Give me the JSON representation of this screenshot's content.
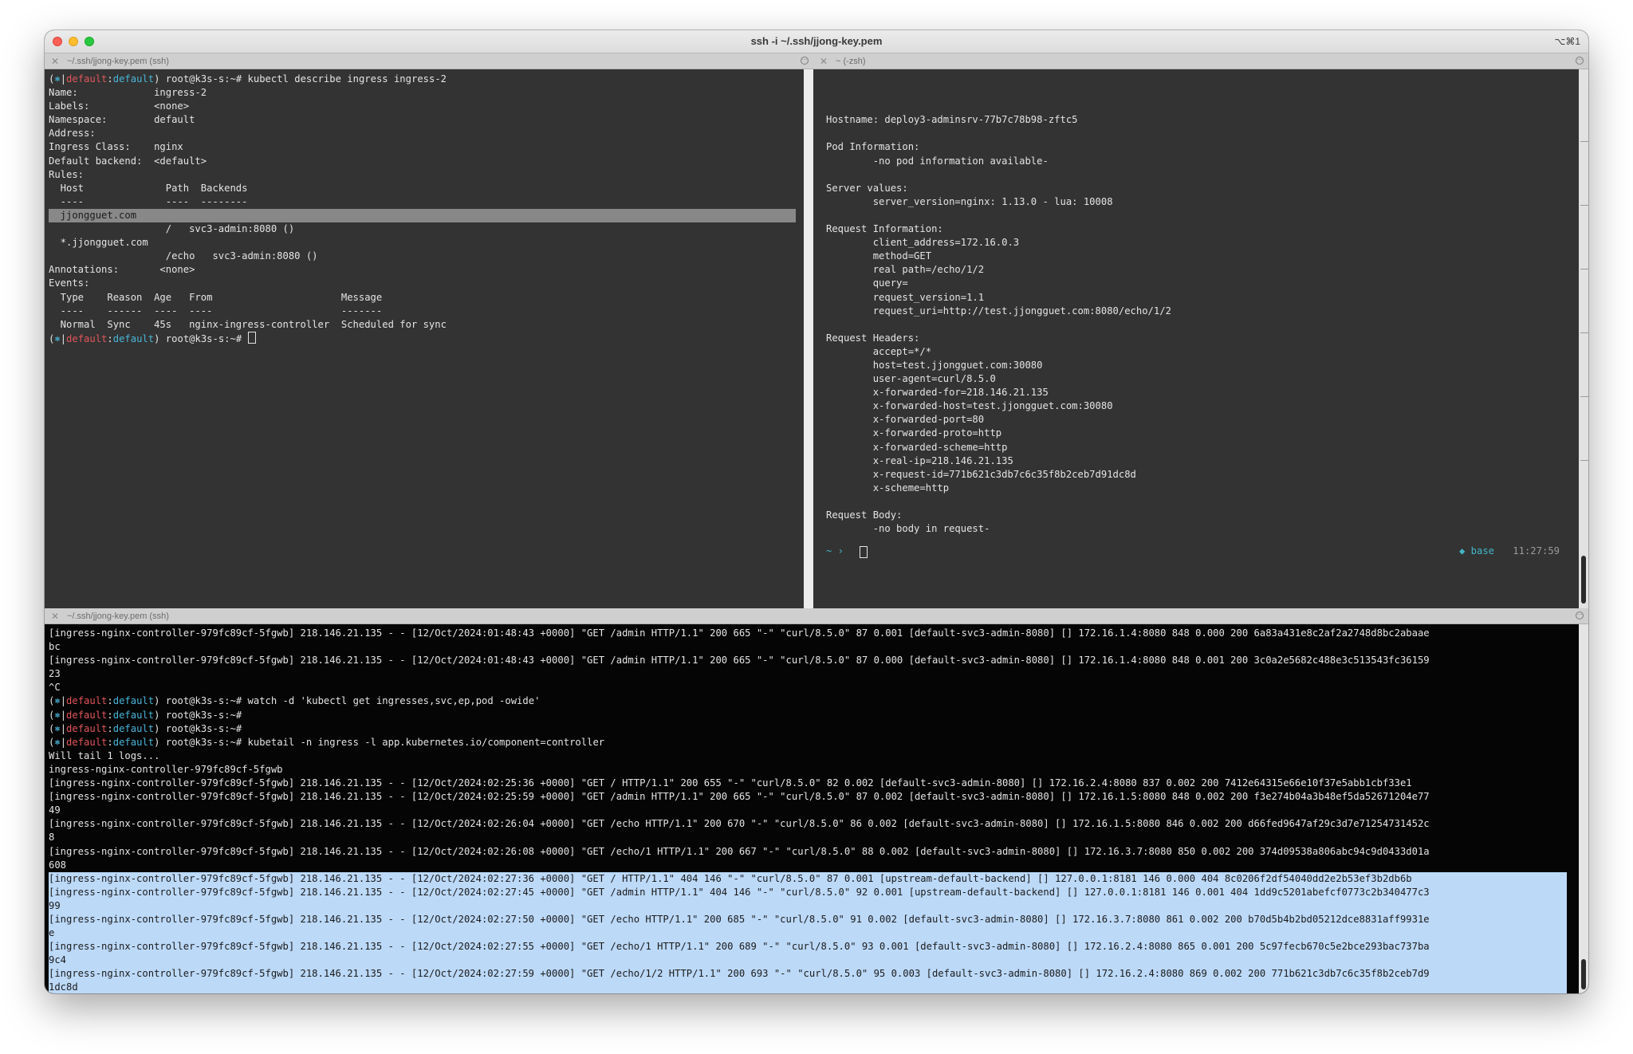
{
  "window": {
    "title": "ssh -i ~/.ssh/jjong-key.pem",
    "shortcut": "⌥⌘1"
  },
  "panes": {
    "top_left": {
      "tab_label": "~/.ssh/jjong-key.pem (ssh)"
    },
    "top_right": {
      "tab_label": "~ (-zsh)"
    },
    "bottom": {
      "tab_label": "~/.ssh/jjong-key.pem (ssh)"
    }
  },
  "prompt": {
    "open": "(",
    "star": "⎈",
    "sep": "|",
    "ctx": "default",
    "colon": ":",
    "ns": "default",
    "close": ")",
    "user": " root@k3s-s:~# "
  },
  "describe": {
    "command": "kubectl describe ingress ingress-2",
    "lines": [
      "Name:             ingress-2",
      "Labels:           <none>",
      "Namespace:        default",
      "Address:",
      "Ingress Class:    nginx",
      "Default backend:  <default>",
      "Rules:",
      "  Host              Path  Backends",
      "  ----              ----  --------",
      "  jjongguet.com",
      "                    /   svc3-admin:8080 ()",
      "  *.jjongguet.com",
      "                    /echo   svc3-admin:8080 ()",
      "Annotations:       <none>",
      "Events:",
      "  Type    Reason  Age   From                      Message",
      "  ----    ------  ----  ----                      -------",
      "  Normal  Sync    45s   nginx-ingress-controller  Scheduled for sync"
    ]
  },
  "echo_output": {
    "lines": [
      "",
      "",
      "",
      "Hostname: deploy3-adminsrv-77b7c78b98-zftc5",
      "",
      "Pod Information:",
      "        -no pod information available-",
      "",
      "Server values:",
      "        server_version=nginx: 1.13.0 - lua: 10008",
      "",
      "Request Information:",
      "        client_address=172.16.0.3",
      "        method=GET",
      "        real path=/echo/1/2",
      "        query=",
      "        request_version=1.1",
      "        request_uri=http://test.jjongguet.com:8080/echo/1/2",
      "",
      "Request Headers:",
      "        accept=*/*",
      "        host=test.jjongguet.com:30080",
      "        user-agent=curl/8.5.0",
      "        x-forwarded-for=218.146.21.135",
      "        x-forwarded-host=test.jjongguet.com:30080",
      "        x-forwarded-port=80",
      "        x-forwarded-proto=http",
      "        x-forwarded-scheme=http",
      "        x-real-ip=218.146.21.135",
      "        x-request-id=771b621c3db7c6c35f8b2ceb7d91dc8d",
      "        x-scheme=http",
      "",
      "Request Body:",
      "        -no body in request-"
    ],
    "zsh_prompt": "~ ›",
    "status_env": "◆ base",
    "status_time": "11:27:59"
  },
  "logs": {
    "before": [
      "[ingress-nginx-controller-979fc89cf-5fgwb] 218.146.21.135 - - [12/Oct/2024:01:48:43 +0000] \"GET /admin HTTP/1.1\" 200 665 \"-\" \"curl/8.5.0\" 87 0.001 [default-svc3-admin-8080] [] 172.16.1.4:8080 848 0.000 200 6a83a431e8c2af2a2748d8bc2abaae",
      "bc",
      "[ingress-nginx-controller-979fc89cf-5fgwb] 218.146.21.135 - - [12/Oct/2024:01:48:43 +0000] \"GET /admin HTTP/1.1\" 200 665 \"-\" \"curl/8.5.0\" 87 0.000 [default-svc3-admin-8080] [] 172.16.1.4:8080 848 0.001 200 3c0a2e5682c488e3c513543fc36159",
      "23",
      "^C"
    ],
    "commands": [
      "watch -d 'kubectl get ingresses,svc,ep,pod -owide'",
      "",
      "",
      "kubetail -n ingress -l app.kubernetes.io/component=controller"
    ],
    "after": [
      "Will tail 1 logs...",
      "ingress-nginx-controller-979fc89cf-5fgwb",
      "[ingress-nginx-controller-979fc89cf-5fgwb] 218.146.21.135 - - [12/Oct/2024:02:25:36 +0000] \"GET / HTTP/1.1\" 200 655 \"-\" \"curl/8.5.0\" 82 0.002 [default-svc3-admin-8080] [] 172.16.2.4:8080 837 0.002 200 7412e64315e66e10f37e5abb1cbf33e1",
      "[ingress-nginx-controller-979fc89cf-5fgwb] 218.146.21.135 - - [12/Oct/2024:02:25:59 +0000] \"GET /admin HTTP/1.1\" 200 665 \"-\" \"curl/8.5.0\" 87 0.002 [default-svc3-admin-8080] [] 172.16.1.5:8080 848 0.002 200 f3e274b04a3b48ef5da52671204e77",
      "49",
      "[ingress-nginx-controller-979fc89cf-5fgwb] 218.146.21.135 - - [12/Oct/2024:02:26:04 +0000] \"GET /echo HTTP/1.1\" 200 670 \"-\" \"curl/8.5.0\" 86 0.002 [default-svc3-admin-8080] [] 172.16.1.5:8080 846 0.002 200 d66fed9647af29c3d7e71254731452c",
      "8",
      "[ingress-nginx-controller-979fc89cf-5fgwb] 218.146.21.135 - - [12/Oct/2024:02:26:08 +0000] \"GET /echo/1 HTTP/1.1\" 200 667 \"-\" \"curl/8.5.0\" 88 0.002 [default-svc3-admin-8080] [] 172.16.3.7:8080 850 0.002 200 374d09538a806abc94c9d0433d01a",
      "608"
    ],
    "selected": [
      "[ingress-nginx-controller-979fc89cf-5fgwb] 218.146.21.135 - - [12/Oct/2024:02:27:36 +0000] \"GET / HTTP/1.1\" 404 146 \"-\" \"curl/8.5.0\" 87 0.001 [upstream-default-backend] [] 127.0.0.1:8181 146 0.000 404 8c0206f2df54040dd2e2b53ef3b2db6b",
      "[ingress-nginx-controller-979fc89cf-5fgwb] 218.146.21.135 - - [12/Oct/2024:02:27:45 +0000] \"GET /admin HTTP/1.1\" 404 146 \"-\" \"curl/8.5.0\" 92 0.001 [upstream-default-backend] [] 127.0.0.1:8181 146 0.001 404 1dd9c5201abefcf0773c2b340477c3",
      "99",
      "[ingress-nginx-controller-979fc89cf-5fgwb] 218.146.21.135 - - [12/Oct/2024:02:27:50 +0000] \"GET /echo HTTP/1.1\" 200 685 \"-\" \"curl/8.5.0\" 91 0.002 [default-svc3-admin-8080] [] 172.16.3.7:8080 861 0.002 200 b70d5b4b2bd05212dce8831aff9931e",
      "e",
      "[ingress-nginx-controller-979fc89cf-5fgwb] 218.146.21.135 - - [12/Oct/2024:02:27:55 +0000] \"GET /echo/1 HTTP/1.1\" 200 689 \"-\" \"curl/8.5.0\" 93 0.001 [default-svc3-admin-8080] [] 172.16.2.4:8080 865 0.001 200 5c97fecb670c5e2bce293bac737ba",
      "9c4",
      "[ingress-nginx-controller-979fc89cf-5fgwb] 218.146.21.135 - - [12/Oct/2024:02:27:59 +0000] \"GET /echo/1/2 HTTP/1.1\" 200 693 \"-\" \"curl/8.5.0\" 95 0.003 [default-svc3-admin-8080] [] 172.16.2.4:8080 869 0.002 200 771b621c3db7c6c35f8b2ceb7d9",
      "1dc8d",
      " "
    ]
  }
}
